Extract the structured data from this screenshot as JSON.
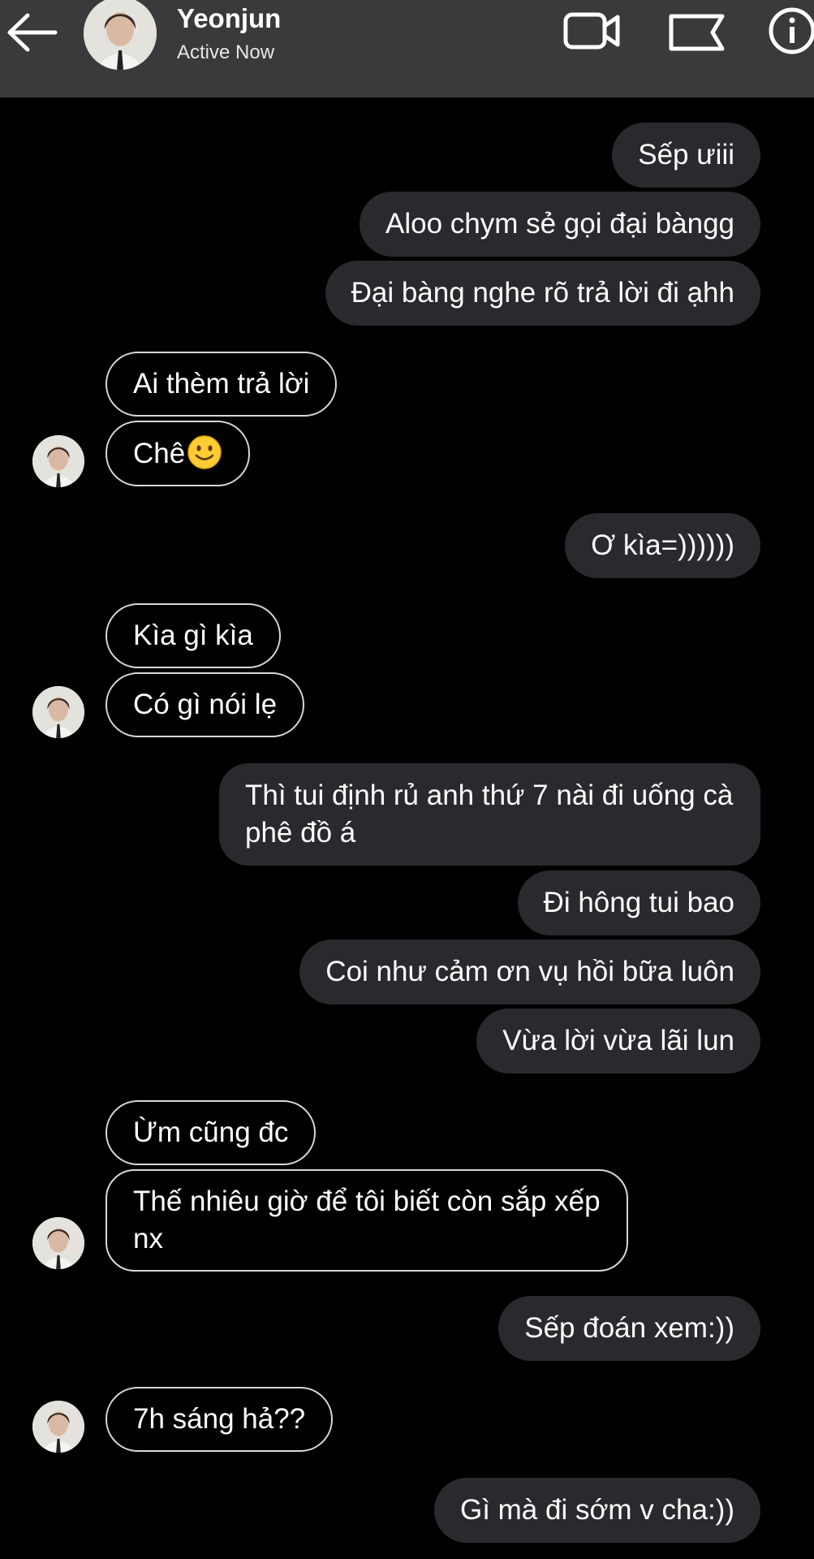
{
  "header": {
    "name": "Yeonjun",
    "status": "Active Now",
    "icons": [
      "back-arrow-icon",
      "video-call-icon",
      "flag-icon",
      "info-icon"
    ]
  },
  "messages": [
    {
      "from": "me",
      "text": "Sếp ưiii"
    },
    {
      "from": "me",
      "text": "Aloo chym sẻ gọi đại bàngg"
    },
    {
      "from": "me",
      "text": "Đại bàng nghe rõ trả lời đi ạhh"
    },
    {
      "from": "them",
      "text": "Ai thèm trả lời"
    },
    {
      "from": "them",
      "text": "Chê",
      "emoji": "slightly-smiling-face"
    },
    {
      "from": "me",
      "text": "Ơ kìa=))))))"
    },
    {
      "from": "them",
      "text": "Kìa gì kìa"
    },
    {
      "from": "them",
      "text": "Có gì nói lẹ"
    },
    {
      "from": "me",
      "text": "Thì tui định rủ anh thứ 7 nài đi uống cà phê đồ á"
    },
    {
      "from": "me",
      "text": "Đi hông tui bao"
    },
    {
      "from": "me",
      "text": "Coi như cảm ơn vụ hồi bữa luôn"
    },
    {
      "from": "me",
      "text": "Vừa lời vừa lãi lun"
    },
    {
      "from": "them",
      "text": "Ừm cũng đc"
    },
    {
      "from": "them",
      "text": "Thế nhiêu giờ để tôi biết còn sắp xếp nx"
    },
    {
      "from": "me",
      "text": "Sếp đoán xem:))"
    },
    {
      "from": "them",
      "text": "7h sáng hả??"
    },
    {
      "from": "me",
      "text": "Gì mà đi sớm v cha:))"
    }
  ],
  "colors": {
    "header_bg": "#3a3a3c",
    "background": "#000000",
    "outgoing_bubble": "#2a2a2e",
    "incoming_border": "#d8d8d8",
    "text": "#ffffff"
  }
}
